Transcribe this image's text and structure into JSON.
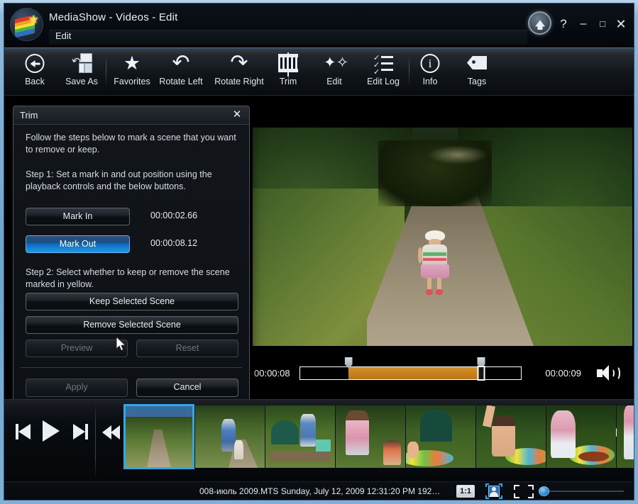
{
  "window": {
    "title": "MediaShow - Videos - Edit",
    "breadcrumb": "Edit",
    "logo_icon": "mediashow-rainbow-star-logo",
    "upload_icon": "upload-arrow-up-icon",
    "help_label": "?",
    "minimize_label": "–",
    "maximize_label": "□",
    "close_label": "✕"
  },
  "toolbar": {
    "items": [
      {
        "label": "Back",
        "icon": "back-arrow-icon"
      },
      {
        "label": "Save As",
        "icon": "save-as-icon"
      },
      {
        "label": "Favorites",
        "icon": "star-icon"
      },
      {
        "label": "Rotate Left",
        "icon": "rotate-left-icon"
      },
      {
        "label": "Rotate Right",
        "icon": "rotate-right-icon"
      },
      {
        "label": "Trim",
        "icon": "film-trim-icon"
      },
      {
        "label": "Edit",
        "icon": "magic-wand-icon"
      },
      {
        "label": "Edit Log",
        "icon": "checklist-icon"
      },
      {
        "label": "Info",
        "icon": "info-circle-icon"
      },
      {
        "label": "Tags",
        "icon": "tag-icon"
      }
    ]
  },
  "trim_dialog": {
    "title": "Trim",
    "close_icon": "close-icon",
    "intro": "Follow the steps below to mark a scene that you want to remove or keep.",
    "step1": "Step 1: Set a mark in and out position using the playback controls and the below buttons.",
    "step2": "Step 2: Select whether to keep or remove the scene marked in yellow.",
    "mark_in_label": "Mark In",
    "mark_in_time": "00:00:02.66",
    "mark_out_label": "Mark Out",
    "mark_out_time": "00:00:08.12",
    "keep_label": "Keep Selected Scene",
    "remove_label": "Remove Selected Scene",
    "preview_label": "Preview",
    "reset_label": "Reset",
    "apply_label": "Apply",
    "cancel_label": "Cancel"
  },
  "player": {
    "current_time": "00:00:08",
    "total_time": "00:00:09",
    "volume_icon": "speaker-volume-icon",
    "mark_in_percent": 22,
    "mark_out_percent": 82,
    "playhead_percent": 82
  },
  "filmstrip": {
    "controls": [
      {
        "name": "skip-to-start-button",
        "icon": "skip-previous-icon"
      },
      {
        "name": "play-button",
        "icon": "play-icon"
      },
      {
        "name": "skip-to-end-button",
        "icon": "skip-next-icon"
      },
      {
        "name": "rewind-button",
        "icon": "rewind-icon"
      },
      {
        "name": "fast-forward-button",
        "icon": "fast-forward-icon"
      }
    ],
    "thumbnails": [
      {
        "caption": "path-through-trees",
        "selected": true
      },
      {
        "caption": "woman-with-child-on-trail",
        "selected": false
      },
      {
        "caption": "man-at-table-with-umbrella",
        "selected": false
      },
      {
        "caption": "woman-and-child-in-garden",
        "selected": false
      },
      {
        "caption": "child-by-inflatable-pool",
        "selected": false
      },
      {
        "caption": "child-with-arm-raised",
        "selected": false
      },
      {
        "caption": "woman-bending-over-pool",
        "selected": false
      },
      {
        "caption": "woman-and-child-at-pool",
        "selected": false
      }
    ]
  },
  "status_bar": {
    "text": "008-июль 2009.MTS  Sunday, July 12, 2009 12:31:20 PM  192…",
    "ratio_label": "1:1",
    "person_icon": "face-detection-icon",
    "fullscreen_icon": "fullscreen-icon",
    "zoom_slider_icon": "zoom-slider-knob"
  },
  "colors": {
    "accent_blue": "#2fa8e8",
    "selection_orange": "#c8821d",
    "frame_blue": "#7fb0d6",
    "panel_dark": "#0d1014"
  }
}
